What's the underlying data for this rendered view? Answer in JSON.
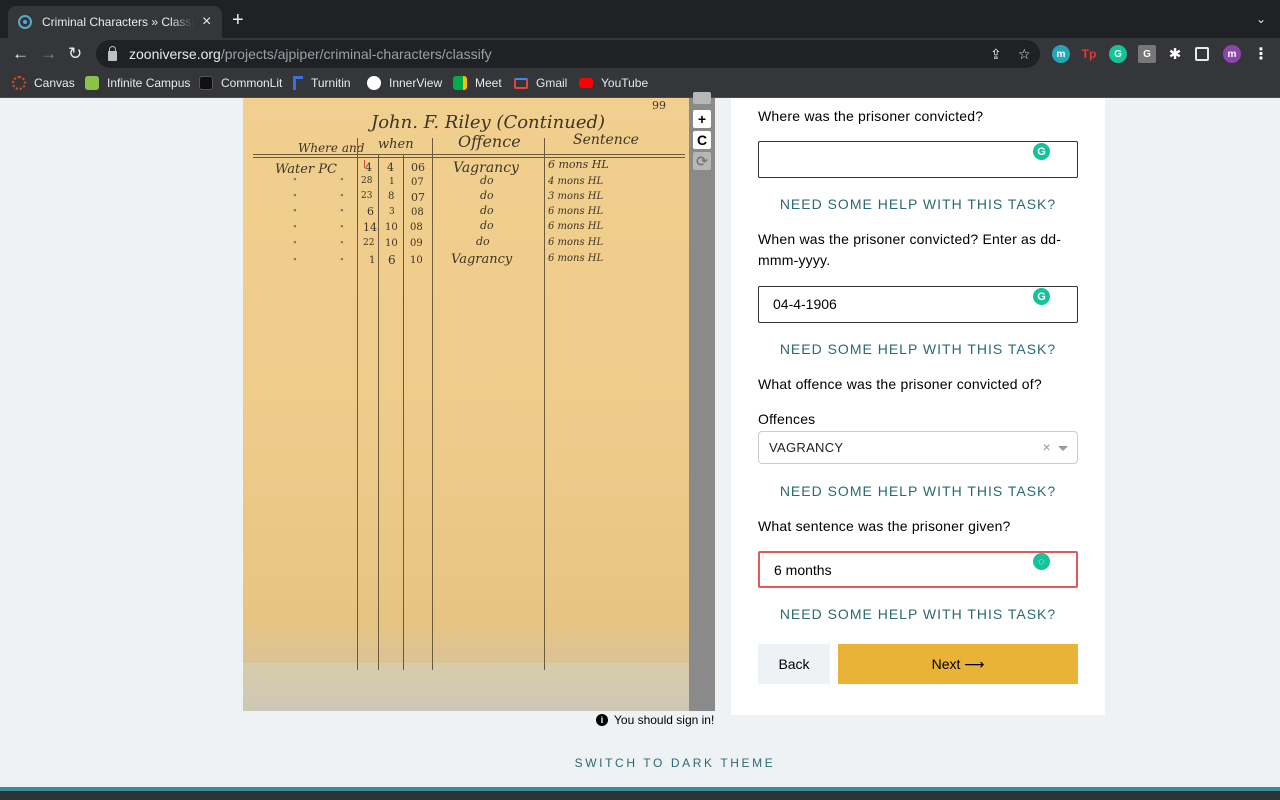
{
  "browser": {
    "tab_title": "Criminal Characters » Classify",
    "tab_close": "×",
    "new_tab": "+",
    "url_host": "zooniverse.org",
    "url_path": "/projects/ajpiper/criminal-characters/classify",
    "bookmarks": [
      {
        "label": "Canvas",
        "color": "#e64a19"
      },
      {
        "label": "Infinite Campus",
        "color": "#8bc34a"
      },
      {
        "label": "CommonLit",
        "color": "#222222"
      },
      {
        "label": "Turnitin",
        "color": "#3b6ee0"
      },
      {
        "label": "InnerView",
        "color": "#ffffff"
      },
      {
        "label": "Meet",
        "color": "#00ac47"
      },
      {
        "label": "Gmail",
        "color": "#ea4335"
      },
      {
        "label": "YouTube",
        "color": "#ff0000"
      }
    ],
    "extensions": [
      "m",
      "Tp",
      "G",
      "G"
    ],
    "profile": "m"
  },
  "document": {
    "page_number": "99",
    "heading": "John. F. Riley (Continued)",
    "columns": [
      "Where and",
      "when",
      "Offence",
      "Sentence"
    ],
    "rows": [
      {
        "place": "Water PC",
        "d": "4",
        "m": "4",
        "y": "06",
        "offence": "Vagrancy",
        "sentence": "6 mons HL"
      },
      {
        "place": "\"",
        "place2": "\"",
        "d": "28",
        "m": "1",
        "y": "07",
        "offence": "do",
        "sentence": "4 mons HL"
      },
      {
        "place": "\"",
        "place2": "\"",
        "d": "23",
        "m": "8",
        "y": "07",
        "offence": "do",
        "sentence": "3 mons HL"
      },
      {
        "place": "\"",
        "place2": "\"",
        "d": "6",
        "m": "3",
        "y": "08",
        "offence": "do",
        "sentence": "6 mons HL"
      },
      {
        "place": "\"",
        "place2": "\"",
        "d": "14",
        "m": "10",
        "y": "08",
        "offence": "do",
        "sentence": "6 mons HL"
      },
      {
        "place": "\"",
        "place2": "\"",
        "d": "22",
        "m": "10",
        "y": "09",
        "offence": "do",
        "sentence": "6 mons HL"
      },
      {
        "place": "\"",
        "place2": "\"",
        "d": "1",
        "m": "6",
        "y": "10",
        "offence": "Vagrancy",
        "sentence": "6 mons HL"
      }
    ]
  },
  "viewer_controls": {
    "zoom_in": "+",
    "reset": "C",
    "rotate": "⟳"
  },
  "signin_notice": "You should sign in!",
  "task": {
    "q1": "Where was the prisoner convicted?",
    "q1_value": "",
    "q2": "When was the prisoner convicted? Enter as dd-mmm-yyyy.",
    "q2_value": "04-4-1906",
    "q3": "What offence was the prisoner convicted of?",
    "q3_label": "Offences",
    "q3_value": "VAGRANCY",
    "q4": "What sentence was the prisoner given?",
    "q4_value": "6 months",
    "help": "NEED SOME HELP WITH THIS TASK?",
    "back": "Back",
    "next": "Next ⟶"
  },
  "footer": {
    "dark_theme": "SWITCH TO DARK THEME"
  }
}
